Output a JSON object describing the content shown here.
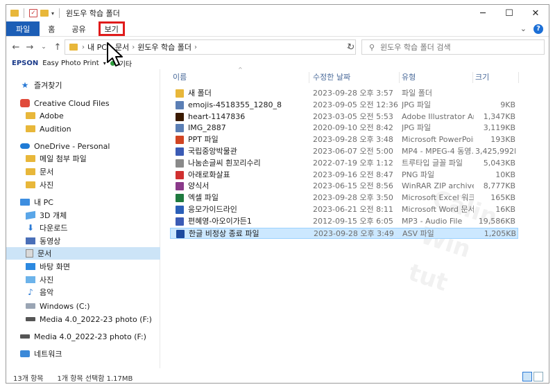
{
  "window": {
    "title": "윈도우 학습 폴더",
    "controls": {
      "minimize": "─",
      "maximize": "☐",
      "close": "✕"
    }
  },
  "ribbon": {
    "tabs": [
      {
        "label": "파일"
      },
      {
        "label": "홈"
      },
      {
        "label": "공유"
      },
      {
        "label": "보기"
      }
    ],
    "highlight_color": "#e01b1b",
    "file_tab_color": "#1c5eb6"
  },
  "address": {
    "crumbs": [
      "내 PC",
      "문서",
      "윈도우 학습 폴더"
    ],
    "search_placeholder": "윈도우 학습 폴더 검색"
  },
  "epson_bar": {
    "brand": "EPSON",
    "app": "Easy Photo Print",
    "extra": "기타"
  },
  "nav": {
    "items": [
      {
        "label": "즐겨찾기",
        "icon": "star-icon"
      },
      {
        "label": "Creative Cloud Files",
        "icon": "creative-cloud-icon"
      },
      {
        "label": "Adobe",
        "icon": "folder-icon"
      },
      {
        "label": "Audition",
        "icon": "folder-icon"
      },
      {
        "label": "OneDrive - Personal",
        "icon": "onedrive-icon"
      },
      {
        "label": "메일 첨부 파일",
        "icon": "folder-icon"
      },
      {
        "label": "문서",
        "icon": "folder-icon"
      },
      {
        "label": "사진",
        "icon": "folder-icon"
      },
      {
        "label": "내 PC",
        "icon": "pc-icon"
      },
      {
        "label": "3D 개체",
        "icon": "cube-icon"
      },
      {
        "label": "다운로드",
        "icon": "download-icon"
      },
      {
        "label": "동영상",
        "icon": "video-icon"
      },
      {
        "label": "문서",
        "icon": "document-icon"
      },
      {
        "label": "바탕 화면",
        "icon": "desktop-icon"
      },
      {
        "label": "사진",
        "icon": "pictures-icon"
      },
      {
        "label": "음악",
        "icon": "music-icon"
      },
      {
        "label": "Windows (C:)",
        "icon": "drive-icon"
      },
      {
        "label": "Media 4.0_2022-23 photo (F:)",
        "icon": "usb-drive-icon"
      },
      {
        "label": "Media 4.0_2022-23 photo (F:)",
        "icon": "usb-drive-icon"
      },
      {
        "label": "네트워크",
        "icon": "network-icon"
      }
    ],
    "selected_color": "#cce4f7"
  },
  "columns": {
    "name": "이름",
    "date": "수정한 날짜",
    "type": "유형",
    "size": "크기"
  },
  "files": [
    {
      "name": "새 폴더",
      "date": "2023-09-28 오후 3:57",
      "type": "파일 폴더",
      "size": "",
      "color": "#e8b73a"
    },
    {
      "name": "emojis-4518355_1280_8",
      "date": "2023-09-05 오전 12:36",
      "type": "JPG 파일",
      "size": "9KB",
      "color": "#5b7fb5"
    },
    {
      "name": "heart-1147836",
      "date": "2023-03-05 오전 5:53",
      "type": "Adobe Illustrator Art...",
      "size": "1,347KB",
      "color": "#3a1a00"
    },
    {
      "name": "IMG_2887",
      "date": "2020-09-10 오전 8:42",
      "type": "JPG 파일",
      "size": "3,119KB",
      "color": "#5b7fb5"
    },
    {
      "name": "PPT 파일",
      "date": "2023-09-28 오후 3:48",
      "type": "Microsoft PowerPoin...",
      "size": "193KB",
      "color": "#d04423"
    },
    {
      "name": "국립중앙박물관",
      "date": "2023-06-07 오전 5:00",
      "type": "MP4 - MPEG-4 동영...",
      "size": "3,425,992KB",
      "color": "#3b5bb5"
    },
    {
      "name": "나눔손글씨 흰꼬리수리",
      "date": "2022-07-19 오후 1:12",
      "type": "트루타입 글꼴 파일",
      "size": "5,043KB",
      "color": "#8a8a8a"
    },
    {
      "name": "아래로화살표",
      "date": "2023-09-16 오전 8:47",
      "type": "PNG 파일",
      "size": "10KB",
      "color": "#d03030"
    },
    {
      "name": "양식서",
      "date": "2023-06-15 오전 8:56",
      "type": "WinRAR ZIP archive",
      "size": "8,777KB",
      "color": "#8a3a8a"
    },
    {
      "name": "엑셀 파일",
      "date": "2023-09-28 오후 3:50",
      "type": "Microsoft Excel 워크...",
      "size": "165KB",
      "color": "#1f7a3f"
    },
    {
      "name": "응모가이드라인",
      "date": "2023-06-21 오전 8:11",
      "type": "Microsoft Word 문서",
      "size": "16KB",
      "color": "#2b5fb8"
    },
    {
      "name": "편혜영-아오이가든1",
      "date": "2012-09-15 오후 6:05",
      "type": "MP3 - Audio File",
      "size": "19,586KB",
      "color": "#3b5bb5"
    },
    {
      "name": "한글 비정상 종료 파일",
      "date": "2023-09-28 오후 3:49",
      "type": "ASV 파일",
      "size": "1,205KB",
      "color": "#1c4aa0"
    }
  ],
  "selected_row_color": "#cce8ff",
  "watermark": [
    "Câlin",
    "Win",
    "tut"
  ],
  "status": {
    "count": "13개 항목",
    "selection": "1개 항목 선택함 1.17MB"
  }
}
